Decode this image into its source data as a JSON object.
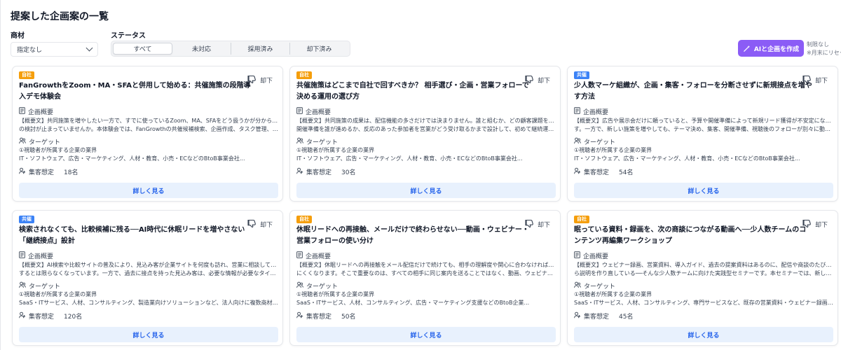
{
  "page": {
    "title": "提案した企画案の一覧"
  },
  "filters": {
    "product_label": "商材",
    "product_value": "指定なし",
    "status_label": "ステータス",
    "status_tabs": [
      "すべて",
      "未対応",
      "採用済み",
      "却下済み"
    ],
    "active_tab": "すべて"
  },
  "ai": {
    "button_label": "AIと企画を作成",
    "note_line1": "制限なし",
    "note_line2": "※月末にリセット"
  },
  "labels": {
    "reject": "却下",
    "overview": "企画概要",
    "target": "ターゲット",
    "attendance_prefix": "集客想定",
    "detail": "詳しく見る"
  },
  "colors": {
    "accent": "#8b5cf6",
    "self_badge": "#f59e0b",
    "co_badge": "#3b82f6",
    "detail_text": "#2563eb"
  },
  "cards": [
    {
      "badge": "自社",
      "badge_type": "self",
      "title": "FanGrowthをZoom・MA・SFAと併用して始める：共催施策の段階導入デモ体験会",
      "overview_line1": "【概要文】共同施策を増やしたい一方で、すでに使っているZoom、MA、SFAをどう扱うかが分からず、導入",
      "overview_line2": "の検討が止まっていませんか。本体験会では、FanGrowthの共催候補検索、企画作成、タスク管理、申込・...",
      "target_line1": "①視聴者が所属する企業の業界",
      "target_line2": "IT・ソフトウェア、広告・マーケティング、人材・教育、小売・ECなどのBtoB事業会社...",
      "attendance": "18名"
    },
    {
      "badge": "自社",
      "badge_type": "self",
      "title": "共催施策はどこまで自社で回すべきか？ 相手選び・企画・営業フォローで決める運用の選び方",
      "overview_line1": "【概要文】共同施策の成果は、配信機能の多さだけでは決まりません。誰と組むか、どの顧客課題を扱うか、",
      "overview_line2": "開催準備を誰が進めるか、反応のあった参加者を営業がどう受け取るかまで設計して、初めて継続運用につ...",
      "target_line1": "①視聴者が所属する企業の業界",
      "target_line2": "IT・ソフトウェア、広告・マーケティング、人材・教育、小売・ECなどのBtoB事業会社...",
      "attendance": "30名"
    },
    {
      "badge": "共催",
      "badge_type": "co",
      "title": "少人数マーケ組織が、企画・集客・フォローを分断させずに新規接点を増やす方法",
      "overview_line1": "【概要文】広告や展示会だけに頼っていると、予算や開催準備によって新規リード獲得が不安定になりがちで",
      "overview_line2": "す。一方で、新しい施策を増やしても、テーマ決め、集客、開催準備、視聴後のフォローが別々に動けば、...",
      "target_line1": "①視聴者が所属する企業の業界",
      "target_line2": "IT・ソフトウェア、広告・マーケティング、人材・教育、小売・ECなどのBtoB事業会社...",
      "attendance": "54名"
    },
    {
      "badge": "共催",
      "badge_type": "co",
      "title": "検索されなくても、比較候補に残る──AI時代に休眠リードを増やさない「継続接点」設計",
      "overview_line1": "【概要文】AI検索や比較サイトの普及により、見込み客が企業サイトを何度も訪れ、営業に相談してから比較",
      "overview_line2": "するとは限らなくなっています。一方で、過去に接点を持った見込み客は、必要な情報が必要なタイミング...",
      "target_line1": "①視聴者が所属する企業の業界",
      "target_line2": "SaaS・ITサービス、人材、コンサルティング、製造業向けソリューションなど、法人向けに複数商材を扱う...",
      "attendance": "120名"
    },
    {
      "badge": "自社",
      "badge_type": "self",
      "title": "休眠リードへの再接触、メールだけで終わらせない──動画・ウェビナー・営業フォローの使い分け",
      "overview_line1": "【概要文】休眠リードへの再接触をメール配信だけで続けても、相手の理解度や関心に合わなければ反応は得",
      "overview_line2": "にくくなります。そこで重要なのは、すべての相手に同じ案内を送ることではなく、動画、ウェビナー録画...",
      "target_line1": "①視聴者が所属する企業の業界",
      "target_line2": "SaaS・ITサービス、人材、コンサルティング、広告・マーケティング支援などのBtoB企業...",
      "attendance": "50名"
    },
    {
      "badge": "自社",
      "badge_type": "self",
      "title": "眠っている資料・録画を、次の商談につながる動画へ──少人数チームのコンテンツ再編集ワークショップ",
      "overview_line1": "【概要文】ウェビナー録画、営業資料、導入ガイド、過去の提案資料はあるのに、配信や商談のたびにゼロか",
      "overview_line2": "ら説明を作り直している──そんな少人数チームに向けた実践型セミナーです。本セミナーでは、新しいコ...",
      "target_line1": "①視聴者が所属する企業の業界",
      "target_line2": "SaaS・ITサービス、人材、コンサルティング、専門サービスなど、既存の営業資料・ウェビナー録画を保有...",
      "attendance": "45名"
    }
  ]
}
